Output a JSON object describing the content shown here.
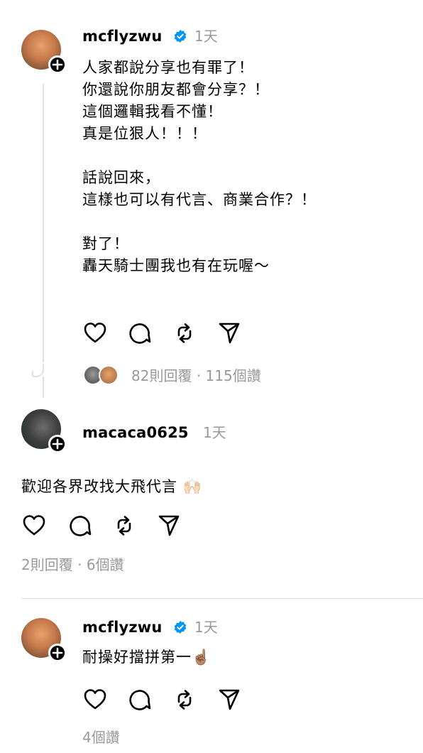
{
  "post1": {
    "username": "mcflyzwu",
    "time": "1天",
    "lines": "人家都說分享也有罪了！\n你還說你朋友都會分享？！\n這個邏輯我看不懂！\n真是位狠人！！！\n\n話說回來，\n這樣也可以有代言、商業合作？！\n\n對了！\n轟天騎士團我也有在玩喔～",
    "replies": "82則回覆",
    "views": "115個讚",
    "dot": "·"
  },
  "post2": {
    "username": "macaca0625",
    "time": "1天",
    "text": "歡迎各界改找大飛代言 🙌🏻",
    "replies": "2則回覆",
    "dot": "·",
    "likes": "6個讚"
  },
  "post3": {
    "username": "mcflyzwu",
    "time": "1天",
    "text": "耐操好擋拼第一☝🏽",
    "likes": "4個讚"
  },
  "colors": {
    "verified": "#0095f6",
    "muted": "#999999",
    "divider": "#dbdbdb"
  }
}
